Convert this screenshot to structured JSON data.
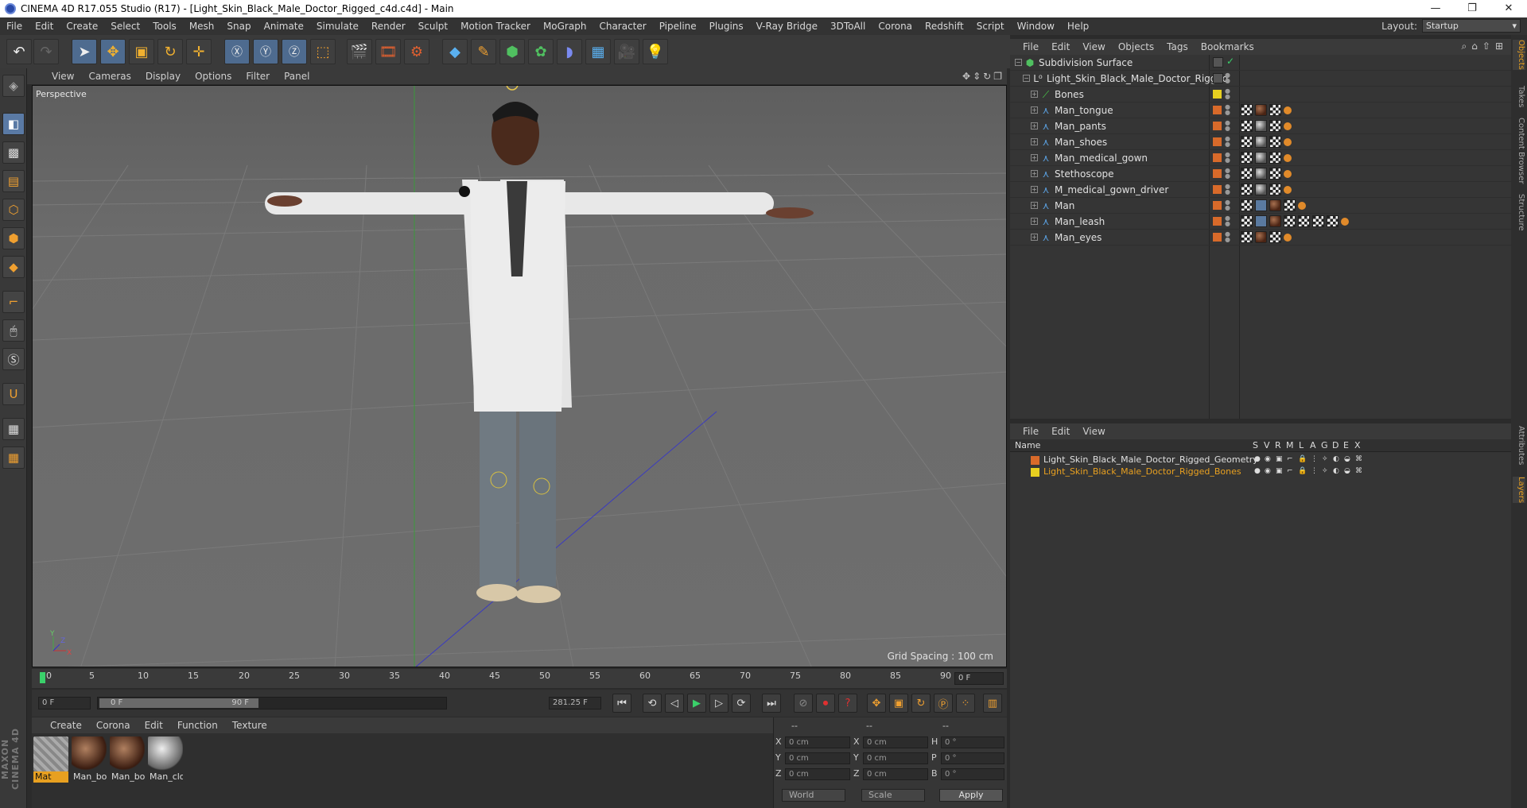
{
  "window": {
    "title": "CINEMA 4D R17.055 Studio (R17) - [Light_Skin_Black_Male_Doctor_Rigged_c4d.c4d] - Main",
    "minimize": "—",
    "maximize": "❐",
    "close": "✕"
  },
  "menubar": {
    "items": [
      "File",
      "Edit",
      "Create",
      "Select",
      "Tools",
      "Mesh",
      "Snap",
      "Animate",
      "Simulate",
      "Render",
      "Sculpt",
      "Motion Tracker",
      "MoGraph",
      "Character",
      "Pipeline",
      "Plugins",
      "V-Ray Bridge",
      "3DToAll",
      "Corona",
      "Redshift",
      "Script",
      "Window",
      "Help"
    ],
    "layout_label": "Layout:",
    "layout_value": "Startup"
  },
  "viewport": {
    "menu": [
      "View",
      "Cameras",
      "Display",
      "Options",
      "Filter",
      "Panel"
    ],
    "label": "Perspective",
    "grid_spacing": "Grid Spacing : 100 cm",
    "axis_x": "X",
    "axis_y": "Y",
    "axis_z": "Z"
  },
  "timeline": {
    "ticks": [
      "0",
      "5",
      "10",
      "15",
      "20",
      "25",
      "30",
      "35",
      "40",
      "45",
      "50",
      "55",
      "60",
      "65",
      "70",
      "75",
      "80",
      "85",
      "90"
    ],
    "current_frame": "0 F",
    "start_field": "0 F",
    "range_start": "0 F",
    "range_end": "90 F",
    "end_field": "281.25 F"
  },
  "material_manager": {
    "menu": [
      "Create",
      "Corona",
      "Edit",
      "Function",
      "Texture"
    ],
    "materials": [
      "Mat",
      "Man_bo",
      "Man_bo",
      "Man_clo"
    ]
  },
  "coordinates": {
    "headers": [
      "--",
      "--",
      "--"
    ],
    "rows": [
      {
        "l1": "X",
        "v1": "0 cm",
        "l2": "X",
        "v2": "0 cm",
        "l3": "H",
        "v3": "0 °"
      },
      {
        "l1": "Y",
        "v1": "0 cm",
        "l2": "Y",
        "v2": "0 cm",
        "l3": "P",
        "v3": "0 °"
      },
      {
        "l1": "Z",
        "v1": "0 cm",
        "l2": "Z",
        "v2": "0 cm",
        "l3": "B",
        "v3": "0 °"
      }
    ],
    "world": "World",
    "scale": "Scale",
    "apply": "Apply"
  },
  "object_manager": {
    "menu": [
      "File",
      "Edit",
      "View",
      "Objects",
      "Tags",
      "Bookmarks"
    ],
    "objects": [
      {
        "name": "Subdivision Surface"
      },
      {
        "name": "Light_Skin_Black_Male_Doctor_Rigged"
      },
      {
        "name": "Bones"
      },
      {
        "name": "Man_tongue"
      },
      {
        "name": "Man_pants"
      },
      {
        "name": "Man_shoes"
      },
      {
        "name": "Man_medical_gown"
      },
      {
        "name": "Stethoscope"
      },
      {
        "name": "M_medical_gown_driver"
      },
      {
        "name": "Man"
      },
      {
        "name": "Man_leash"
      },
      {
        "name": "Man_eyes"
      }
    ]
  },
  "layer_manager": {
    "menu": [
      "File",
      "Edit",
      "View"
    ],
    "name_header": "Name",
    "columns": [
      "S",
      "V",
      "R",
      "M",
      "L",
      "A",
      "G",
      "D",
      "E",
      "X"
    ],
    "layers": [
      {
        "name": "Light_Skin_Black_Male_Doctor_Rigged_Geometry",
        "color": "#d86a2a"
      },
      {
        "name": "Light_Skin_Black_Male_Doctor_Rigged_Bones",
        "color": "#e8d020"
      }
    ]
  },
  "side_tabs": [
    "Objects",
    "Takes",
    "Content Browser",
    "Structure",
    "Attributes",
    "Layers"
  ],
  "logo": "MAXON CINEMA 4D"
}
